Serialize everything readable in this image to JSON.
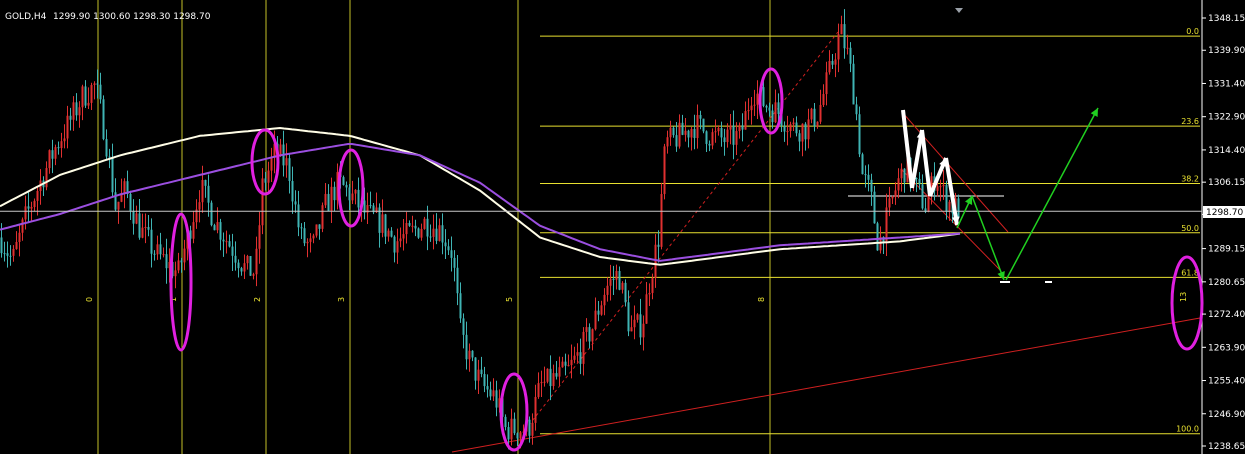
{
  "header": {
    "symbol_timeframe": "GOLD,H4",
    "ohlc": "1299.90 1300.60 1298.30 1298.70"
  },
  "chart_data": {
    "type": "candlestick",
    "symbol": "GOLD",
    "timeframe": "H4",
    "current_price": 1298.7,
    "current_price_label": "1298.70",
    "ylim": [
      1236.0,
      1350.0
    ],
    "y_ticks": [
      "1348.15",
      "1339.90",
      "1331.40",
      "1322.90",
      "1314.40",
      "1306.15",
      "1297.90",
      "1289.15",
      "1280.65",
      "1272.40",
      "1263.90",
      "1255.40",
      "1246.90",
      "1238.65"
    ],
    "price_path": [
      [
        0,
        1292
      ],
      [
        12,
        1286
      ],
      [
        25,
        1297
      ],
      [
        38,
        1305
      ],
      [
        55,
        1315
      ],
      [
        70,
        1322
      ],
      [
        82,
        1328
      ],
      [
        95,
        1331
      ],
      [
        105,
        1318
      ],
      [
        115,
        1300
      ],
      [
        125,
        1304
      ],
      [
        140,
        1294
      ],
      [
        155,
        1288
      ],
      [
        168,
        1285
      ],
      [
        178,
        1283
      ],
      [
        190,
        1295
      ],
      [
        200,
        1305
      ],
      [
        215,
        1296
      ],
      [
        230,
        1290
      ],
      [
        245,
        1284
      ],
      [
        255,
        1283
      ],
      [
        262,
        1305
      ],
      [
        275,
        1314
      ],
      [
        288,
        1310
      ],
      [
        300,
        1292
      ],
      [
        312,
        1289
      ],
      [
        325,
        1300
      ],
      [
        338,
        1306
      ],
      [
        350,
        1303
      ],
      [
        365,
        1298
      ],
      [
        380,
        1296
      ],
      [
        395,
        1291
      ],
      [
        410,
        1293
      ],
      [
        425,
        1296
      ],
      [
        440,
        1294
      ],
      [
        452,
        1288
      ],
      [
        460,
        1268
      ],
      [
        470,
        1260
      ],
      [
        482,
        1254
      ],
      [
        495,
        1251
      ],
      [
        505,
        1243
      ],
      [
        515,
        1243
      ],
      [
        528,
        1243
      ],
      [
        540,
        1254
      ],
      [
        555,
        1256
      ],
      [
        568,
        1258
      ],
      [
        580,
        1263
      ],
      [
        592,
        1269
      ],
      [
        605,
        1279
      ],
      [
        618,
        1283
      ],
      [
        630,
        1268
      ],
      [
        642,
        1270
      ],
      [
        650,
        1282
      ],
      [
        658,
        1292
      ],
      [
        665,
        1316
      ],
      [
        680,
        1318
      ],
      [
        695,
        1321
      ],
      [
        710,
        1318
      ],
      [
        725,
        1317
      ],
      [
        740,
        1318
      ],
      [
        752,
        1330
      ],
      [
        765,
        1326
      ],
      [
        778,
        1324
      ],
      [
        792,
        1320
      ],
      [
        805,
        1320
      ],
      [
        818,
        1324
      ],
      [
        830,
        1335
      ],
      [
        840,
        1345
      ],
      [
        848,
        1338
      ],
      [
        855,
        1326
      ],
      [
        862,
        1308
      ],
      [
        870,
        1303
      ],
      [
        878,
        1290
      ],
      [
        888,
        1298
      ],
      [
        897,
        1306
      ],
      [
        905,
        1310
      ],
      [
        915,
        1305
      ],
      [
        925,
        1300
      ],
      [
        935,
        1308
      ],
      [
        945,
        1302
      ],
      [
        952,
        1300
      ],
      [
        960,
        1299
      ]
    ],
    "moving_averages": [
      {
        "color": "#fffde6",
        "points": [
          [
            0,
            1300
          ],
          [
            60,
            1308
          ],
          [
            120,
            1313
          ],
          [
            200,
            1318
          ],
          [
            280,
            1320
          ],
          [
            350,
            1318
          ],
          [
            420,
            1313
          ],
          [
            480,
            1304
          ],
          [
            540,
            1292
          ],
          [
            600,
            1287
          ],
          [
            660,
            1285
          ],
          [
            720,
            1287
          ],
          [
            780,
            1289
          ],
          [
            840,
            1290
          ],
          [
            900,
            1291
          ],
          [
            960,
            1293
          ]
        ]
      },
      {
        "color": "#9b4fe0",
        "points": [
          [
            0,
            1294
          ],
          [
            60,
            1298
          ],
          [
            120,
            1303
          ],
          [
            200,
            1308
          ],
          [
            280,
            1313
          ],
          [
            350,
            1316
          ],
          [
            420,
            1313
          ],
          [
            480,
            1306
          ],
          [
            540,
            1295
          ],
          [
            600,
            1289
          ],
          [
            660,
            1286
          ],
          [
            720,
            1288
          ],
          [
            780,
            1290
          ],
          [
            840,
            1291
          ],
          [
            900,
            1292
          ],
          [
            960,
            1293
          ]
        ]
      }
    ],
    "fibonacci": {
      "levels": [
        {
          "label": "0.0",
          "price": 1343.5
        },
        {
          "label": "23.6",
          "price": 1320.5
        },
        {
          "label": "38.2",
          "price": 1305.8
        },
        {
          "label": "50.0",
          "price": 1293.2
        },
        {
          "label": "61.8",
          "price": 1281.8
        },
        {
          "label": "100.0",
          "price": 1241.8
        }
      ]
    },
    "cycle_labels": [
      "0",
      "1",
      "2",
      "3",
      "5",
      "8",
      "13"
    ],
    "colors": {
      "background": "#000000",
      "bull_candle": "#e03030",
      "bear_candle": "#3fb4b4",
      "fib_line": "#e8e030",
      "cycle_line": "#e8e030",
      "highlight_ellipse": "#e020e0",
      "projection_up": "#20d020",
      "projection_pattern": "#ffffff",
      "trendline": "#d02020",
      "price_axis": "#ffffff"
    }
  }
}
